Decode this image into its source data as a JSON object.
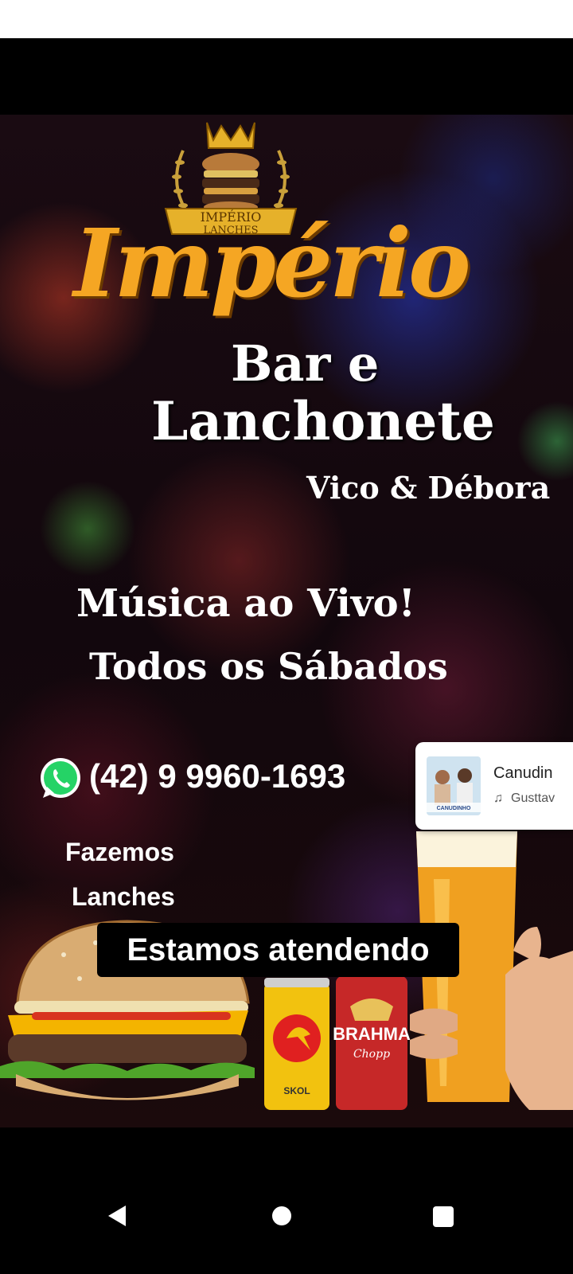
{
  "poster": {
    "logo_line1": "IMPÉRIO",
    "logo_line2": "LANCHES",
    "title_main": "Império",
    "title_sub1": "Bar e",
    "title_sub2": "Lanchonete",
    "owners": "Vico & Débora",
    "music_line1": "Música  ao Vivo!",
    "music_line2": "Todos os Sábados",
    "phone": "(42) 9 9960-1693",
    "food_line1": "Fazemos",
    "food_line2": "Lanches",
    "can1_label": "SKOL",
    "can2_label": "BRAHMA",
    "can2_sub": "Chopp"
  },
  "caption": "Estamos atendendo",
  "music_sticker": {
    "title": "Canudin",
    "artist": "Gusttav",
    "note_icon": "music-note-icon",
    "thumb_text": "CANUDINHO"
  },
  "nav": {
    "back": "back-icon",
    "home": "home-icon",
    "recents": "recents-icon"
  },
  "colors": {
    "title_gold": "#f5a623",
    "whatsapp_green": "#25d366"
  }
}
